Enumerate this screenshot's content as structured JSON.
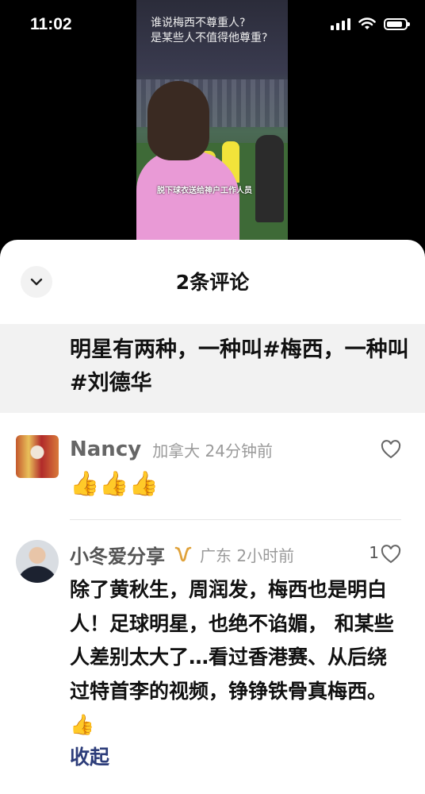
{
  "status_bar": {
    "time": "11:02",
    "battery_level": 0.85
  },
  "video": {
    "caption_top": "谁说梅西不尊重人?\n是某些人不值得他尊重?",
    "caption_bottom": "脱下球衣送给神户工作人员"
  },
  "sheet": {
    "title": "2条评论",
    "quote": "明星有两种，一种叫#梅西，一种叫#刘德华"
  },
  "comments": [
    {
      "name": "Nancy",
      "location_time": "加拿大 24分钟前",
      "body": "👍👍👍",
      "likes": ""
    },
    {
      "name": "小冬爱分享",
      "location_time": "广东 2小时前",
      "body": "除了黄秋生，周润发，梅西也是明白人！足球明星，也绝不谄媚， 和某些人差别太大了…看过香港赛、从后绕过特首李的视频，铮铮铁骨真梅西。👍",
      "likes": "1"
    }
  ],
  "collapse_label": "收起",
  "colors": {
    "link": "#2d3d7a",
    "sheet_bg": "#ffffff",
    "quote_bg": "#f2f2f2"
  }
}
